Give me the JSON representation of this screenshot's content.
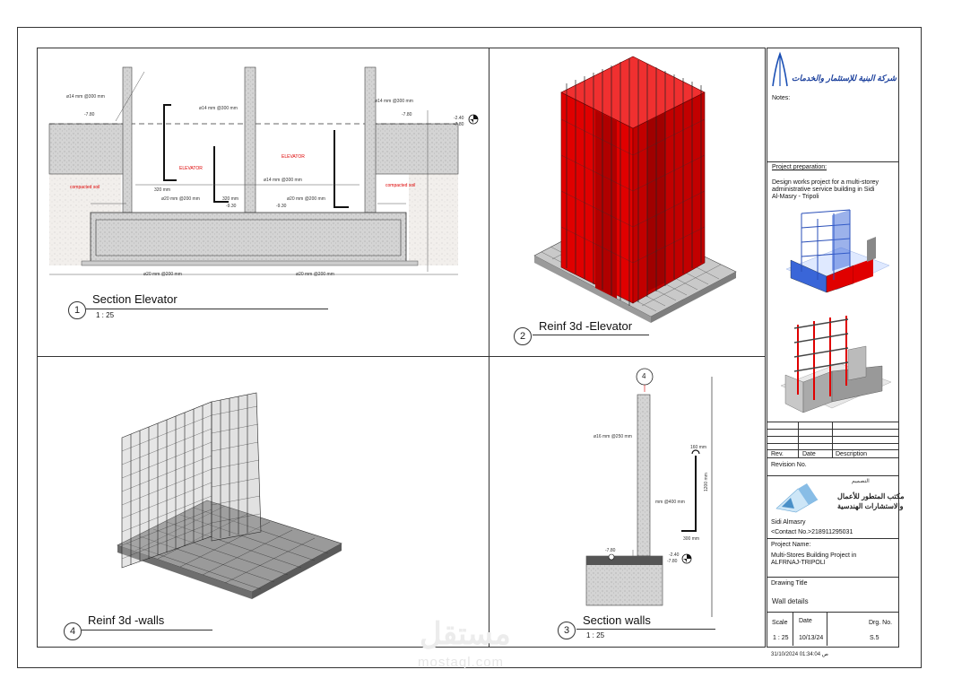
{
  "viewports": [
    {
      "num": "1",
      "title": "Section Elevator",
      "scale": "1 : 25"
    },
    {
      "num": "2",
      "title": "Reinf 3d -Elevator",
      "scale": ""
    },
    {
      "num": "3",
      "title": "Section walls",
      "scale": "1 : 25"
    },
    {
      "num": "4",
      "title": "Reinf 3d -walls",
      "scale": ""
    }
  ],
  "section_elevator": {
    "rebar_top": "ø14 mm @300 mm",
    "rebar_mid": "ø14 mm @300 mm",
    "rebar_right": "ø14 mm @300 mm",
    "rebar_inner": "ø14 mm @300 mm",
    "lvl_left": "-7.80",
    "lvl_right": "-7.80",
    "lvl_marker": "-2.40",
    "lvl_marker2": "-7.80",
    "lvl_930a": "-9.30",
    "lvl_930b": "-9.30",
    "elevator1": "ELEVATOR",
    "elevator2": "ELEVATOR",
    "soil_left": "compacted soil",
    "soil_right": "compacted soil",
    "bar_320a": "320 mm",
    "bar_320b": "320 mm",
    "bar_20a": "ø20 mm @200 mm",
    "bar_20b": "ø20 mm @200 mm",
    "bar_bot_a": "ø20 mm @200 mm",
    "bar_bot_b": "ø20 mm @200 mm",
    "dim_1100a": "1100 mm",
    "dim_1100b": "1100 mm",
    "dim_1100c": "1100 mm"
  },
  "section_walls": {
    "grid": "4",
    "rebar_16": "ø16 mm @250 mm",
    "rebar_400": "mm @400 mm",
    "dim_160": "160 mm",
    "dim_300": "300 mm",
    "dim_1200": "1200 mm",
    "lvl_a": "-7.80",
    "lvl_b": "-2.40",
    "lvl_c": "-7.80"
  },
  "title_block": {
    "company_ar": "شركة البنية للإستثمار والخدمات",
    "notes_label": "Notes:",
    "prep_head": "Project preparation:",
    "prep_text": [
      "Design works project for a multi-storey",
      "administrative service building in Sidi",
      "Al-Masry - Tripoli"
    ],
    "rev_cols": [
      "Rev.",
      "Date",
      "Description"
    ],
    "revision_no": "Revision No.",
    "design_label_ar": "التصميم",
    "office_ar_1": "مكتب المتطور للأعمال",
    "office_ar_2": "والاستشارات الهندسية",
    "contact_name": "Sidi Almasry",
    "contact_no": "<Contact No.>218911295031",
    "project_name_label": "Project Name:",
    "project_name": [
      "Multi-Stores Building Project in",
      "ALFRNAJ-TRIPOLI"
    ],
    "drawing_title_label": "Drawing Title",
    "drawing_title": "Wall details",
    "scale_label": "Scale",
    "scale": "1 : 25",
    "date_label": "Date",
    "date": "10/13/24",
    "drg_label": "Drg. No.",
    "drg_no": "S.5"
  },
  "footer": {
    "timestamp": "31/10/2024 01:34:04 ص",
    "watermark_ar": "مستقل",
    "watermark_url": "mostaql.com"
  },
  "colors": {
    "rebar_red": "#e00000",
    "steel_blue": "#3a66d8",
    "concrete": "#bdbdbd",
    "mesh_dark": "#2a2a2a"
  }
}
